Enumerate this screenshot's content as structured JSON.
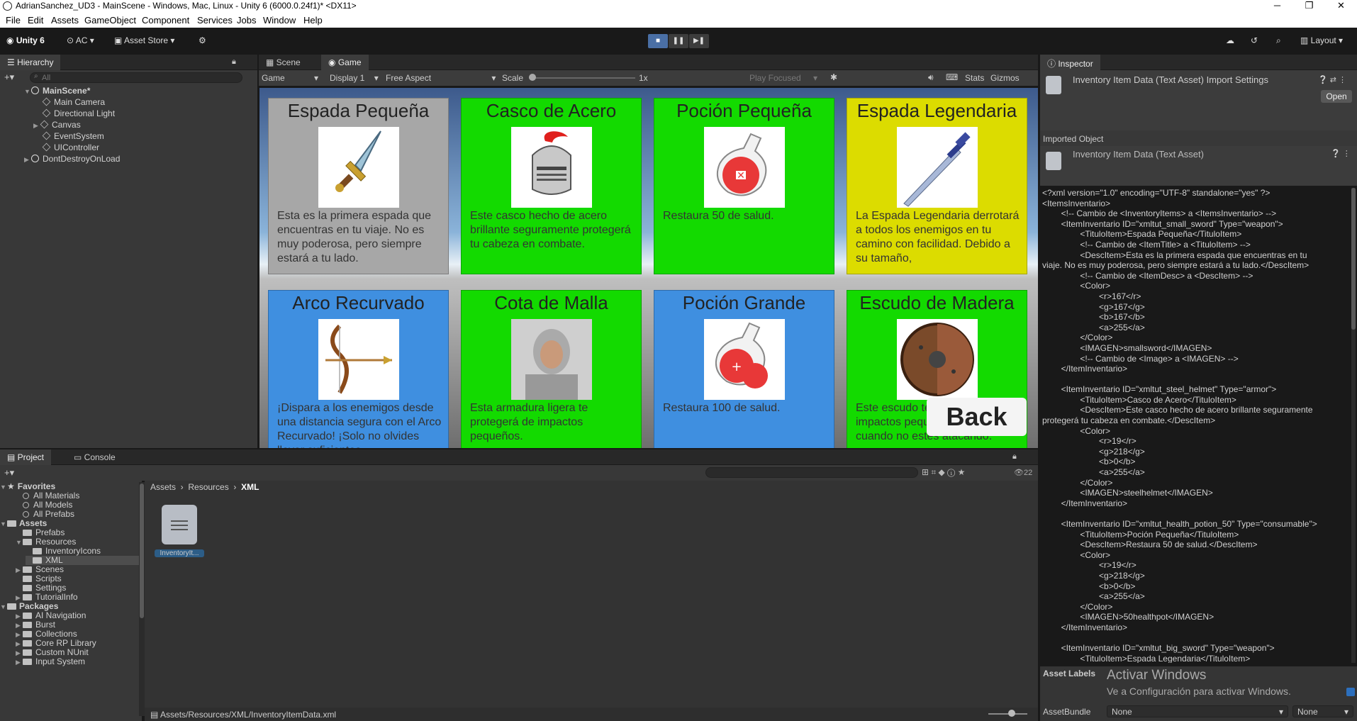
{
  "window": {
    "title": "AdrianSanchez_UD3 - MainScene - Windows, Mac, Linux - Unity 6 (6000.0.24f1)* <DX11>",
    "minimize": "─",
    "maximize": "❐",
    "close": "✕"
  },
  "menu": [
    "File",
    "Edit",
    "Assets",
    "GameObject",
    "Component",
    "Services",
    "Jobs",
    "Window",
    "Help"
  ],
  "toolbar": {
    "unity_label": "Unity 6",
    "account": "AC",
    "asset_store": "Asset Store",
    "layout": "Layout"
  },
  "hierarchy": {
    "tab": "Hierarchy",
    "search_placeholder": "All",
    "items": [
      {
        "label": "MainScene*"
      },
      {
        "label": "Main Camera"
      },
      {
        "label": "Directional Light"
      },
      {
        "label": "Canvas"
      },
      {
        "label": "EventSystem"
      },
      {
        "label": "UIController"
      },
      {
        "label": "DontDestroyOnLoad"
      }
    ]
  },
  "game_view": {
    "tabs": [
      "Scene",
      "Game"
    ],
    "controls": {
      "mode": "Game",
      "display": "Display 1",
      "aspect": "Free Aspect",
      "scale_label": "Scale",
      "scale_value": "1x",
      "play_focused": "Play Focused",
      "stats": "Stats",
      "gizmos": "Gizmos"
    },
    "cards": [
      {
        "title": "Espada Pequeña",
        "desc": "Esta es la primera espada que encuentras en tu viaje. No es muy poderosa, pero siempre estará a tu lado.",
        "color": "#a7a7a7",
        "icon": "small-sword-icon"
      },
      {
        "title": "Casco de Acero",
        "desc": "Este casco hecho de acero brillante seguramente protegerá tu cabeza en combate.",
        "color": "#13da00",
        "icon": "steel-helmet-icon"
      },
      {
        "title": "Poción Pequeña",
        "desc": "Restaura 50 de salud.",
        "color": "#13da00",
        "icon": "small-potion-icon"
      },
      {
        "title": "Espada Legendaria",
        "desc": "La Espada Legendaria derrotará a todos los enemigos en tu camino con facilidad. Debido a su tamaño,",
        "color": "#dcdc00",
        "icon": "legendary-sword-icon"
      },
      {
        "title": "Arco Recurvado",
        "desc": "¡Dispara a los enemigos desde una distancia segura con el Arco Recurvado! ¡Solo no olvides llevar suficientes",
        "color": "#3f8fe0",
        "icon": "recurve-bow-icon"
      },
      {
        "title": "Cota de Malla",
        "desc": "Esta armadura ligera te protegerá de impactos pequeños.",
        "color": "#13da00",
        "icon": "chainmail-icon"
      },
      {
        "title": "Poción Grande",
        "desc": "Restaura 100 de salud.",
        "color": "#3f8fe0",
        "icon": "large-potion-icon"
      },
      {
        "title": "Escudo de Madera",
        "desc": "Este escudo te protegerá de impactos pequeños y medianos cuando no estés atacando.",
        "color": "#13da00",
        "icon": "wooden-shield-icon"
      }
    ],
    "back_button": "Back"
  },
  "project": {
    "tabs": [
      "Project",
      "Console"
    ],
    "hidden_count": "22",
    "breadcrumb": [
      "Assets",
      "Resources",
      "XML"
    ],
    "tree": [
      {
        "label": "Favorites",
        "type": "header"
      },
      {
        "label": "All Materials",
        "type": "search"
      },
      {
        "label": "All Models",
        "type": "search"
      },
      {
        "label": "All Prefabs",
        "type": "search"
      },
      {
        "label": "Assets",
        "type": "header"
      },
      {
        "label": "Prefabs",
        "type": "folder"
      },
      {
        "label": "Resources",
        "type": "folder"
      },
      {
        "label": "InventoryIcons",
        "type": "folder"
      },
      {
        "label": "XML",
        "type": "folder"
      },
      {
        "label": "Scenes",
        "type": "folder"
      },
      {
        "label": "Scripts",
        "type": "folder"
      },
      {
        "label": "Settings",
        "type": "folder"
      },
      {
        "label": "TutorialInfo",
        "type": "folder"
      },
      {
        "label": "Packages",
        "type": "header"
      },
      {
        "label": "AI Navigation",
        "type": "folder"
      },
      {
        "label": "Burst",
        "type": "folder"
      },
      {
        "label": "Collections",
        "type": "folder"
      },
      {
        "label": "Core RP Library",
        "type": "folder"
      },
      {
        "label": "Custom NUnit",
        "type": "folder"
      },
      {
        "label": "Input System",
        "type": "folder"
      }
    ],
    "file_label": "InventoryIt...",
    "status_path": "Assets/Resources/XML/InventoryItemData.xml"
  },
  "inspector": {
    "tab": "Inspector",
    "header": "Inventory Item Data (Text Asset) Import Settings",
    "open_button": "Open",
    "imported_object_label": "Imported Object",
    "imported_object_name": "Inventory Item Data (Text Asset)",
    "xml_lines": [
      "<?xml version=\"1.0\" encoding=\"UTF-8\" standalone=\"yes\" ?>",
      "<ItemsInventario>",
      "        <!-- Cambio de <InventoryItems> a <ItemsInventario> -->",
      "        <ItemInventario ID=\"xmltut_small_sword\" Type=\"weapon\">",
      "                <TituloItem>Espada Pequeña</TituloItem>",
      "                <!-- Cambio de <ItemTitle> a <TituloItem> -->",
      "                <DescItem>Esta es la primera espada que encuentras en tu",
      "viaje. No es muy poderosa, pero siempre estará a tu lado.</DescItem>",
      "                <!-- Cambio de <ItemDesc> a <DescItem> -->",
      "                <Color>",
      "                        <r>167</r>",
      "                        <g>167</g>",
      "                        <b>167</b>",
      "                        <a>255</a>",
      "                </Color>",
      "                <IMAGEN>smallsword</IMAGEN>",
      "                <!-- Cambio de <Image> a <IMAGEN> -->",
      "        </ItemInventario>",
      "",
      "        <ItemInventario ID=\"xmltut_steel_helmet\" Type=\"armor\">",
      "                <TituloItem>Casco de Acero</TituloItem>",
      "                <DescItem>Este casco hecho de acero brillante seguramente",
      "protegerá tu cabeza en combate.</DescItem>",
      "                <Color>",
      "                        <r>19</r>",
      "                        <g>218</g>",
      "                        <b>0</b>",
      "                        <a>255</a>",
      "                </Color>",
      "                <IMAGEN>steelhelmet</IMAGEN>",
      "        </ItemInventario>",
      "",
      "        <ItemInventario ID=\"xmltut_health_potion_50\" Type=\"consumable\">",
      "                <TituloItem>Poción Pequeña</TituloItem>",
      "                <DescItem>Restaura 50 de salud.</DescItem>",
      "                <Color>",
      "                        <r>19</r>",
      "                        <g>218</g>",
      "                        <b>0</b>",
      "                        <a>255</a>",
      "                </Color>",
      "                <IMAGEN>50healthpot</IMAGEN>",
      "        </ItemInventario>",
      "",
      "        <ItemInventario ID=\"xmltut_big_sword\" Type=\"weapon\">",
      "                <TituloItem>Espada Legendaria</TituloItem>"
    ],
    "asset_labels": "Asset Labels",
    "watermark_title": "Activar Windows",
    "watermark_sub": "Ve a Configuración para activar Windows.",
    "assetbundle_label": "AssetBundle",
    "assetbundle_value": "None",
    "assetbundle_variant": "None"
  }
}
